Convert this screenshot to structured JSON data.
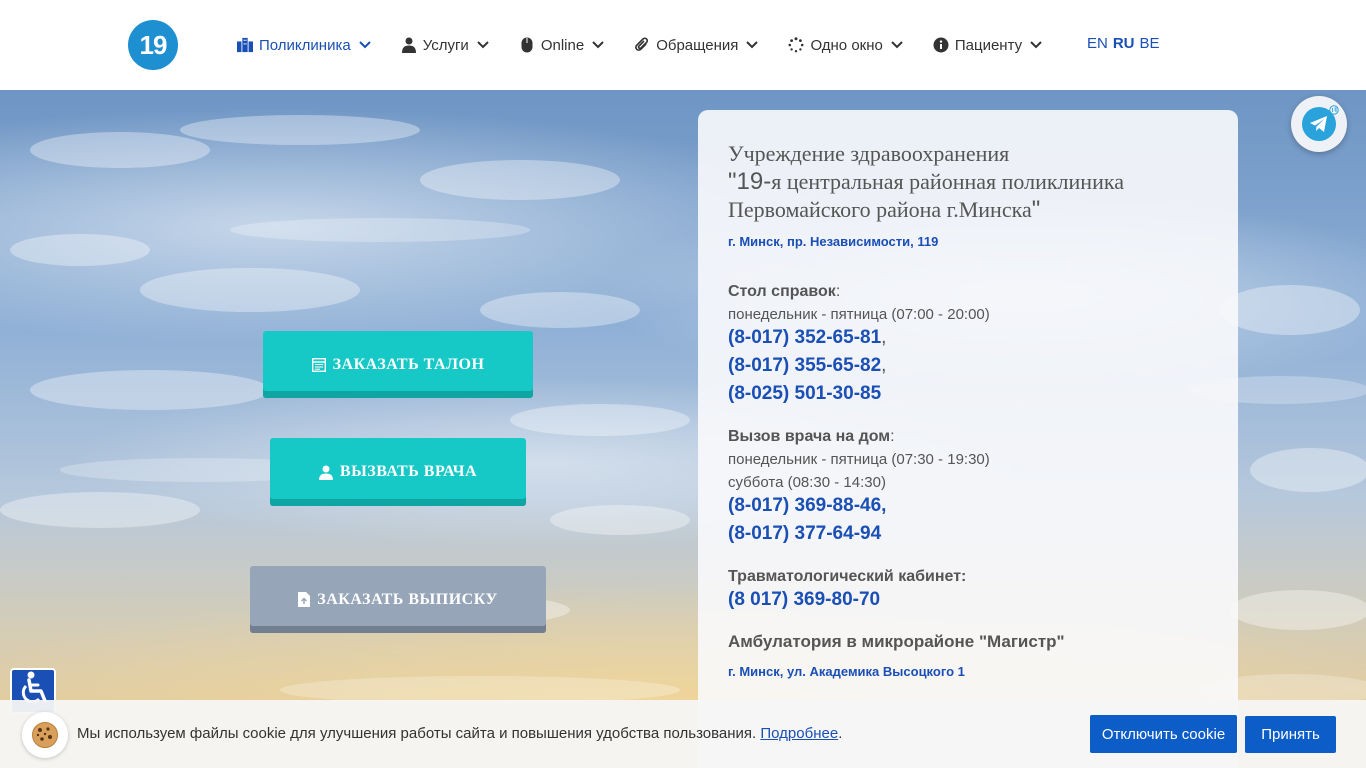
{
  "header": {
    "logo_text": "19",
    "nav": [
      {
        "label": "Поликлиника",
        "icon": "building-icon"
      },
      {
        "label": "Услуги",
        "icon": "user-doctor-icon"
      },
      {
        "label": "Online",
        "icon": "mouse-icon"
      },
      {
        "label": "Обращения",
        "icon": "paperclip-icon"
      },
      {
        "label": "Одно окно",
        "icon": "spinner-icon"
      },
      {
        "label": "Пациенту",
        "icon": "info-icon"
      }
    ],
    "languages": [
      "EN",
      "RU",
      "BE"
    ]
  },
  "hero": {
    "buttons": {
      "talon": "ЗАКАЗАТЬ ТАЛОН",
      "vrach": "ВЫЗВАТЬ ВРАЧА",
      "vypiska": "ЗАКАЗАТЬ ВЫПИСКУ"
    }
  },
  "panel": {
    "title_line1": "Учреждение здравоохранения",
    "title_quote_open": "\"",
    "title_num": "19-",
    "title_line2_rest": "я центральная районная поликлиника",
    "title_line3": "Первомайского района г.Минска",
    "title_quote_close": "\"",
    "address": "г. Минск, пр. Независимости, 119",
    "info_desk": {
      "heading": "Стол справок",
      "hours": "понедельник - пятница (07:00 - 20:00)",
      "phones": [
        "(8-017) 352-65-81",
        "(8-017) 355-65-82",
        "(8-025) 501-30-85"
      ]
    },
    "home_call": {
      "heading": "Вызов врача на дом",
      "hours1": "понедельник - пятница (07:30 - 19:30)",
      "hours2": "суббота (08:30 - 14:30)",
      "phones": [
        "(8-017) 369-88-46",
        "(8-017) 377-64-94"
      ]
    },
    "trauma": {
      "heading": "Травматологический кабинет:",
      "phone": "(8 017) 369-80-70"
    },
    "ambulatory": {
      "title": "Амбулатория в микрорайоне \"Магистр\"",
      "address": "г. Минск, ул. Академика Высоцкого 1"
    }
  },
  "cookie": {
    "text": "Мы используем файлы cookie для улучшения работы сайта и повышения удобства пользования.",
    "more": "Подробнее",
    "period": ".",
    "disable": "Отключить cookie",
    "accept": "Принять"
  },
  "colors": {
    "primary": "#1a4fb5",
    "teal": "#17c9c6",
    "gray_button": "#96a6b8",
    "cookie_button": "#0d5dc9"
  }
}
